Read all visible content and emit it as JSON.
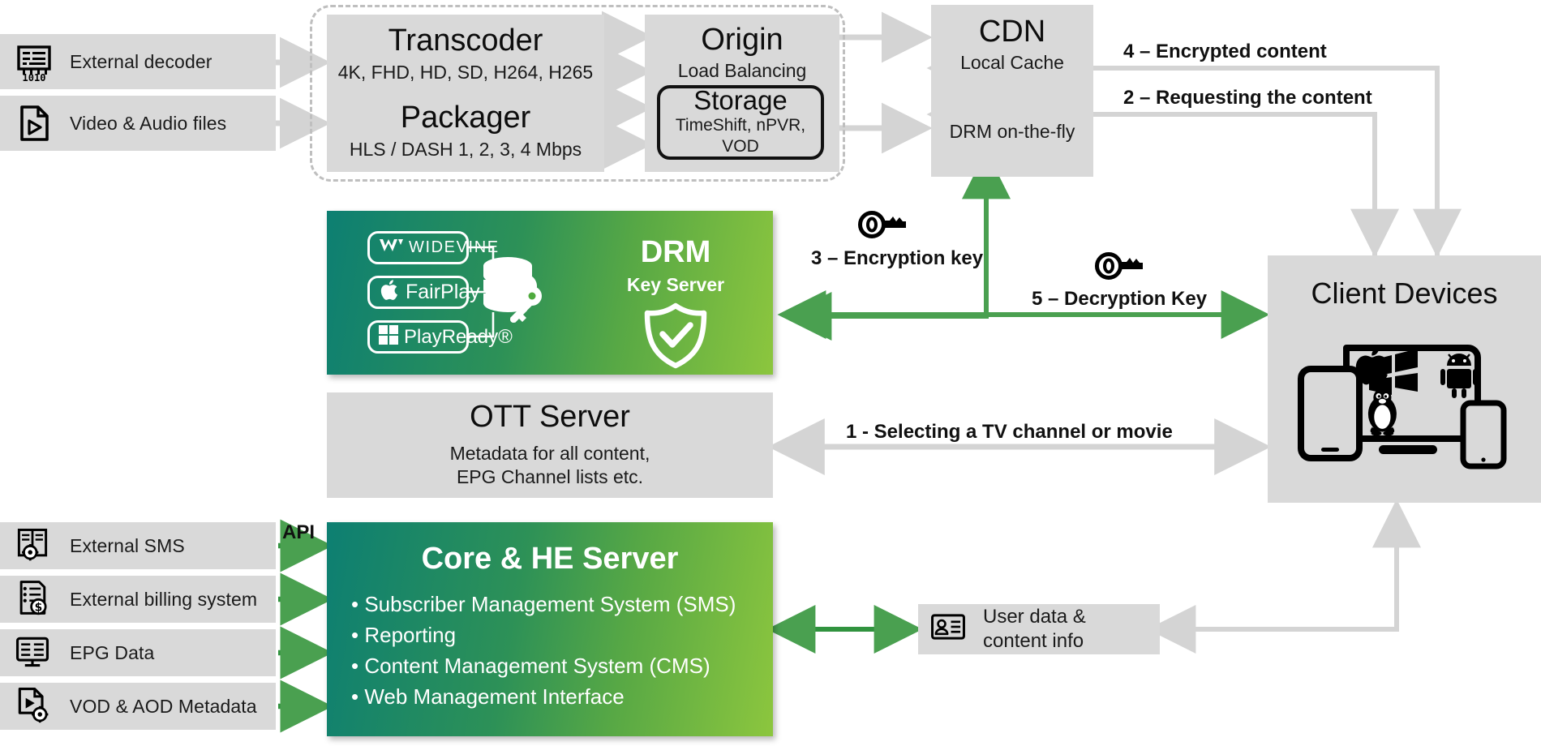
{
  "sources_top": [
    {
      "label": "External decoder",
      "icon": "binary-decoder-icon"
    },
    {
      "label": "Video & Audio files",
      "icon": "video-file-icon"
    }
  ],
  "pipeline": {
    "transcoder": {
      "title": "Transcoder",
      "subtitle": "4K, FHD, HD, SD, H264, H265"
    },
    "packager": {
      "title": "Packager",
      "subtitle": "HLS / DASH 1, 2, 3, 4 Mbps"
    },
    "origin": {
      "title": "Origin",
      "subtitle": "Load Balancing"
    },
    "storage": {
      "title": "Storage",
      "subtitle_line1": "TimeShift, nPVR,",
      "subtitle_line2": "VOD"
    }
  },
  "cdn": {
    "title": "CDN",
    "subtitle": "Local Cache",
    "footer": "DRM on-the-fly"
  },
  "drm": {
    "title": "DRM",
    "subtitle": "Key Server",
    "chips": [
      {
        "label": "WIDEVINE",
        "icon": "widevine-logo-icon"
      },
      {
        "label": "FairPlay",
        "icon": "apple-logo-icon"
      },
      {
        "label": "PlayReady®",
        "icon": "microsoft-squares-icon"
      }
    ],
    "database_icon": "database-key-icon",
    "shield_icon": "shield-check-icon"
  },
  "ott": {
    "title": "OTT Server",
    "subtitle_line1": "Metadata for all content,",
    "subtitle_line2": "EPG Channel lists etc."
  },
  "core": {
    "title": "Core & HE Server",
    "items": [
      "• Subscriber Management System (SMS)",
      "• Reporting",
      "• Content Management System (CMS)",
      "• Web Management Interface"
    ]
  },
  "sources_bottom": [
    {
      "label": "External SMS",
      "icon": "book-gear-icon"
    },
    {
      "label": "External billing system",
      "icon": "invoice-dollar-icon"
    },
    {
      "label": "EPG Data",
      "icon": "epg-monitor-icon"
    },
    {
      "label": "VOD & AOD Metadata",
      "icon": "video-file-gear-icon"
    }
  ],
  "api_label": "API",
  "client_devices": {
    "title": "Client Devices",
    "icons": [
      "tablet-icon",
      "windows-logo-icon",
      "linux-tux-icon",
      "apple-logo-icon",
      "android-robot-icon",
      "laptop-icon",
      "phone-icon"
    ]
  },
  "user_data": {
    "line1": "User data &",
    "line2": "content info",
    "icon": "id-card-icon"
  },
  "flows": [
    {
      "id": "1",
      "label": "1 - Selecting a TV channel or movie",
      "color": "#d4d4d4"
    },
    {
      "id": "2",
      "label": "2 – Requesting the content",
      "color": "#d4d4d4"
    },
    {
      "id": "3",
      "label": "3 – Encryption key",
      "color": "#4aa050",
      "icon": "key-icon"
    },
    {
      "id": "4",
      "label": "4 – Encrypted content",
      "color": "#d4d4d4"
    },
    {
      "id": "5",
      "label": "5 – Decryption Key",
      "color": "#4aa050",
      "icon": "key-icon"
    }
  ],
  "colors": {
    "grey_box": "#d9d9d9",
    "grey_arrow": "#d4d4d4",
    "green_arrow": "#4aa050",
    "green_dark": "#0d7f72",
    "green_light": "#8cc63e",
    "text": "#111111"
  }
}
